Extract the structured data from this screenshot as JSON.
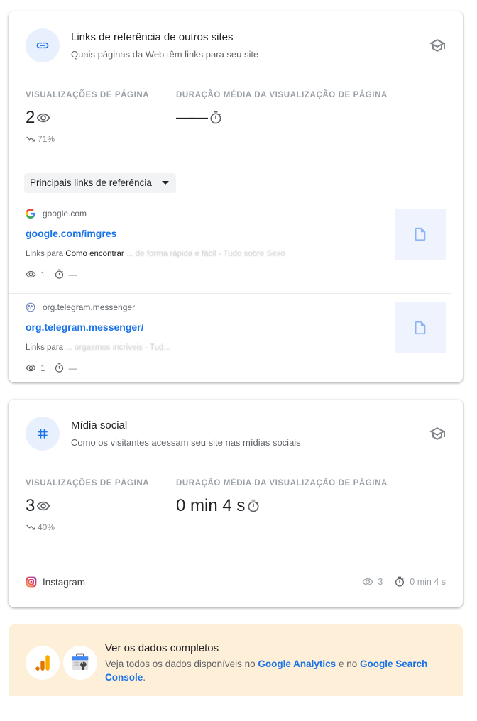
{
  "referrals_card": {
    "title": "Links de referência de outros sites",
    "subtitle": "Quais páginas da Web têm links para seu site",
    "header_icon": "link-icon",
    "learn_icon": "school-icon",
    "metrics": {
      "pageviews_label": "VISUALIZAÇÕES DE PÁGINA",
      "pageviews_value": "2",
      "pageviews_change": "71%",
      "pageviews_trend": "down",
      "duration_label": "DURAÇÃO MÉDIA DA VISUALIZAÇÃO DE PÁGINA",
      "duration_value": "——"
    },
    "dropdown": {
      "selected": "Principais links de referência"
    },
    "links_to_label": "Links para",
    "items": [
      {
        "source": "google.com",
        "source_icon": "google-icon",
        "url": "google.com/imgres",
        "page_title": "Como encontrar",
        "page_title_obscured": "... de forma rápida e fácil - Tudo sobre Sexo",
        "views": "1",
        "duration": "—"
      },
      {
        "source": "org.telegram.messenger",
        "source_icon": "globe-icon",
        "url": "org.telegram.messenger/",
        "page_title": "",
        "page_title_obscured": "... orgasmos incríveis - Tud...",
        "views": "1",
        "duration": "—"
      }
    ]
  },
  "social_card": {
    "title": "Mídia social",
    "subtitle": "Como os visitantes acessam seu site nas mídias sociais",
    "header_icon": "hashtag-icon",
    "learn_icon": "school-icon",
    "metrics": {
      "pageviews_label": "VISUALIZAÇÕES DE PÁGINA",
      "pageviews_value": "3",
      "pageviews_change": "40%",
      "pageviews_trend": "down",
      "duration_label": "DURAÇÃO MÉDIA DA VISUALIZAÇÃO DE PÁGINA",
      "duration_value": "0 min 4 s"
    },
    "items": [
      {
        "name": "Instagram",
        "icon": "instagram-icon",
        "views": "3",
        "duration": "0 min 4 s"
      }
    ]
  },
  "promo": {
    "title": "Ver os dados completos",
    "text_prefix": "Veja todos os dados disponíveis no ",
    "link_analytics": "Google Analytics",
    "text_middle": " e no ",
    "link_search_console": "Google Search Console",
    "text_suffix": "."
  },
  "colors": {
    "accent": "#1a73e8",
    "icon_bg": "#e8f0fe",
    "promo_bg": "#feefd9",
    "analytics_orange": "#f9ab00",
    "analytics_dark_orange": "#e37400"
  }
}
